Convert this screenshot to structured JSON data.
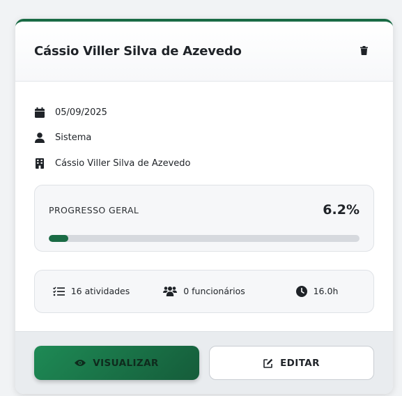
{
  "card": {
    "title": "Cássio Viller Silva de Azevedo",
    "accent_color": "#1a6b45",
    "delete_icon": "trash-icon"
  },
  "meta": {
    "date": "05/09/2025",
    "user": "Sistema",
    "company": "Cássio Viller Silva de Azevedo"
  },
  "progress": {
    "label": "PROGRESSO GERAL",
    "value_text": "6.2%",
    "value": 6.2
  },
  "stats": {
    "activities": "16 atividades",
    "employees": "0 funcionários",
    "hours": "16.0h"
  },
  "actions": {
    "view_label": "VISUALIZAR",
    "edit_label": "EDITAR"
  }
}
